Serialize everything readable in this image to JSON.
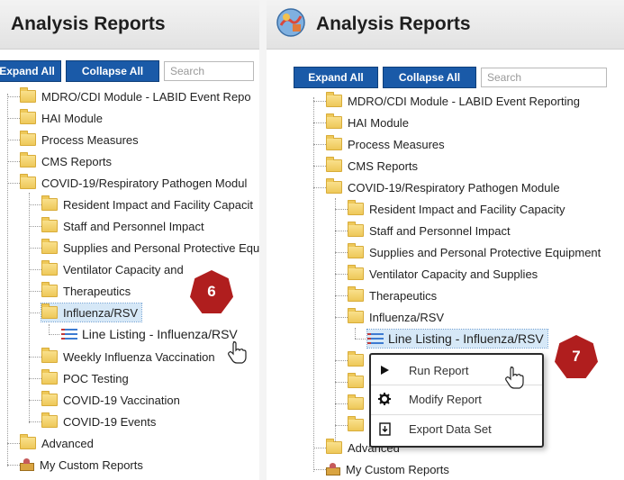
{
  "left_panel": {
    "title": "Analysis Reports",
    "expand_all": "Expand All",
    "collapse_all": "Collapse All",
    "search_placeholder": "Search",
    "items": {
      "mdro": "MDRO/CDI Module - LABID Event Repo",
      "hai": "HAI Module",
      "process": "Process Measures",
      "cms": "CMS Reports",
      "covid_module": "COVID-19/Respiratory Pathogen Modul",
      "resident": "Resident Impact and Facility Capacit",
      "staff": "Staff and Personnel Impact",
      "supplies": "Supplies and Personal Protective Equ",
      "ventilator": "Ventilator Capacity and",
      "therapeutics": "Therapeutics",
      "influenza": "Influenza/RSV",
      "line_listing": "Line Listing - Influenza/RSV",
      "weekly": "Weekly Influenza Vaccination",
      "poc": "POC Testing",
      "covid_vacc": "COVID-19 Vaccination",
      "covid_events": "COVID-19 Events",
      "advanced": "Advanced",
      "custom": "My Custom Reports"
    },
    "step_badge": "6"
  },
  "right_panel": {
    "title": "Analysis Reports",
    "expand_all": "Expand All",
    "collapse_all": "Collapse All",
    "search_placeholder": "Search",
    "items": {
      "mdro": "MDRO/CDI Module - LABID Event Reporting",
      "hai": "HAI Module",
      "process": "Process Measures",
      "cms": "CMS Reports",
      "covid_module": "COVID-19/Respiratory Pathogen Module",
      "resident": "Resident Impact and Facility Capacity",
      "staff": "Staff and Personnel Impact",
      "supplies": "Supplies and Personal Protective Equipment",
      "ventilator": "Ventilator Capacity and Supplies",
      "therapeutics": "Therapeutics",
      "influenza": "Influenza/RSV",
      "line_listing": "Line Listing - Influenza/RSV",
      "advanced": "Advanced",
      "custom": "My Custom Reports"
    },
    "context_menu": {
      "run": "Run Report",
      "modify": "Modify Report",
      "export": "Export Data Set"
    },
    "step_badge": "7"
  },
  "colors": {
    "button_blue": "#1a5aa8",
    "badge_red": "#b01e1e",
    "selection": "#d6e8f7"
  }
}
